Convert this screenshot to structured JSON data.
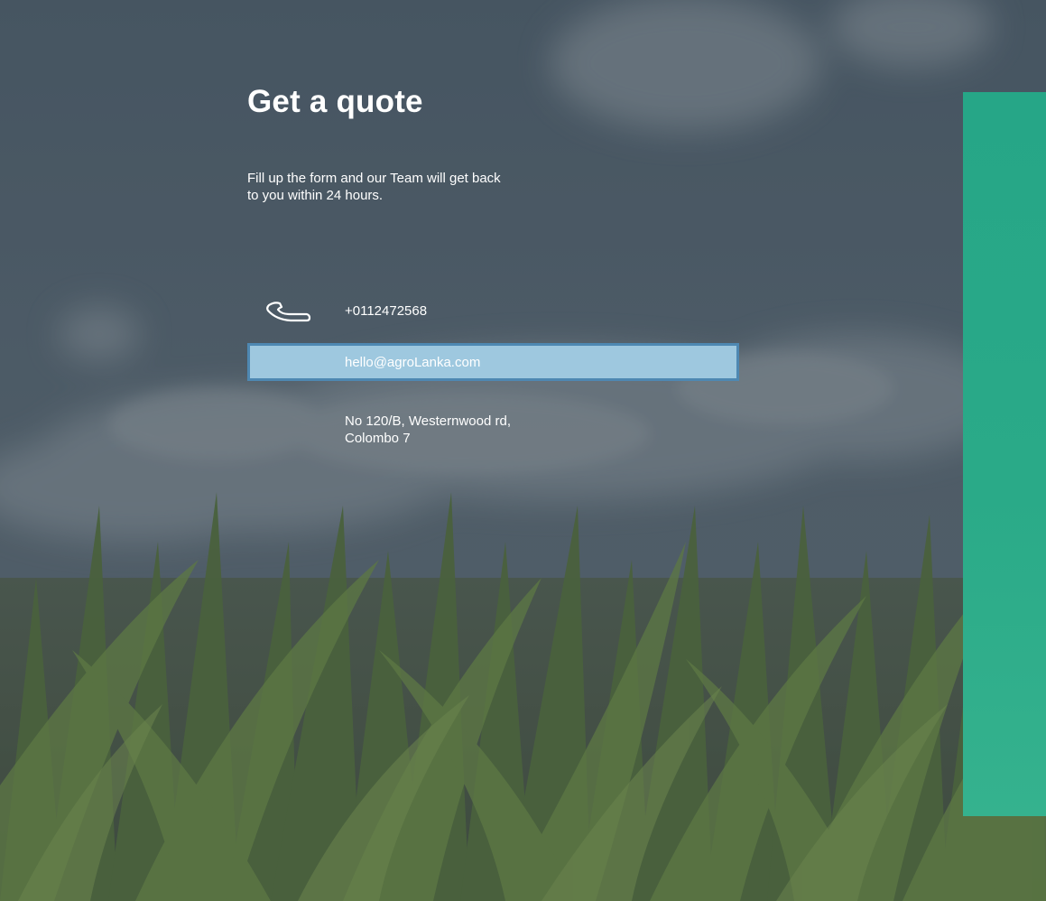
{
  "page": {
    "title": "Get a quote",
    "subtitle": "Fill up the form and our Team will get back to you within 24 hours."
  },
  "contact": {
    "phone": "+0112472568",
    "email": "hello@agroLanka.com",
    "address": "No 120/B, Westernwood rd, Colombo 7"
  },
  "icons": {
    "phone": "phone-icon",
    "email": "mail-icon",
    "address": "location-icon"
  },
  "colors": {
    "overlay": "#4b5a66",
    "highlight_fill": "#9ec8df",
    "highlight_border": "#4e88b2",
    "accent_panel": "#26a687"
  }
}
